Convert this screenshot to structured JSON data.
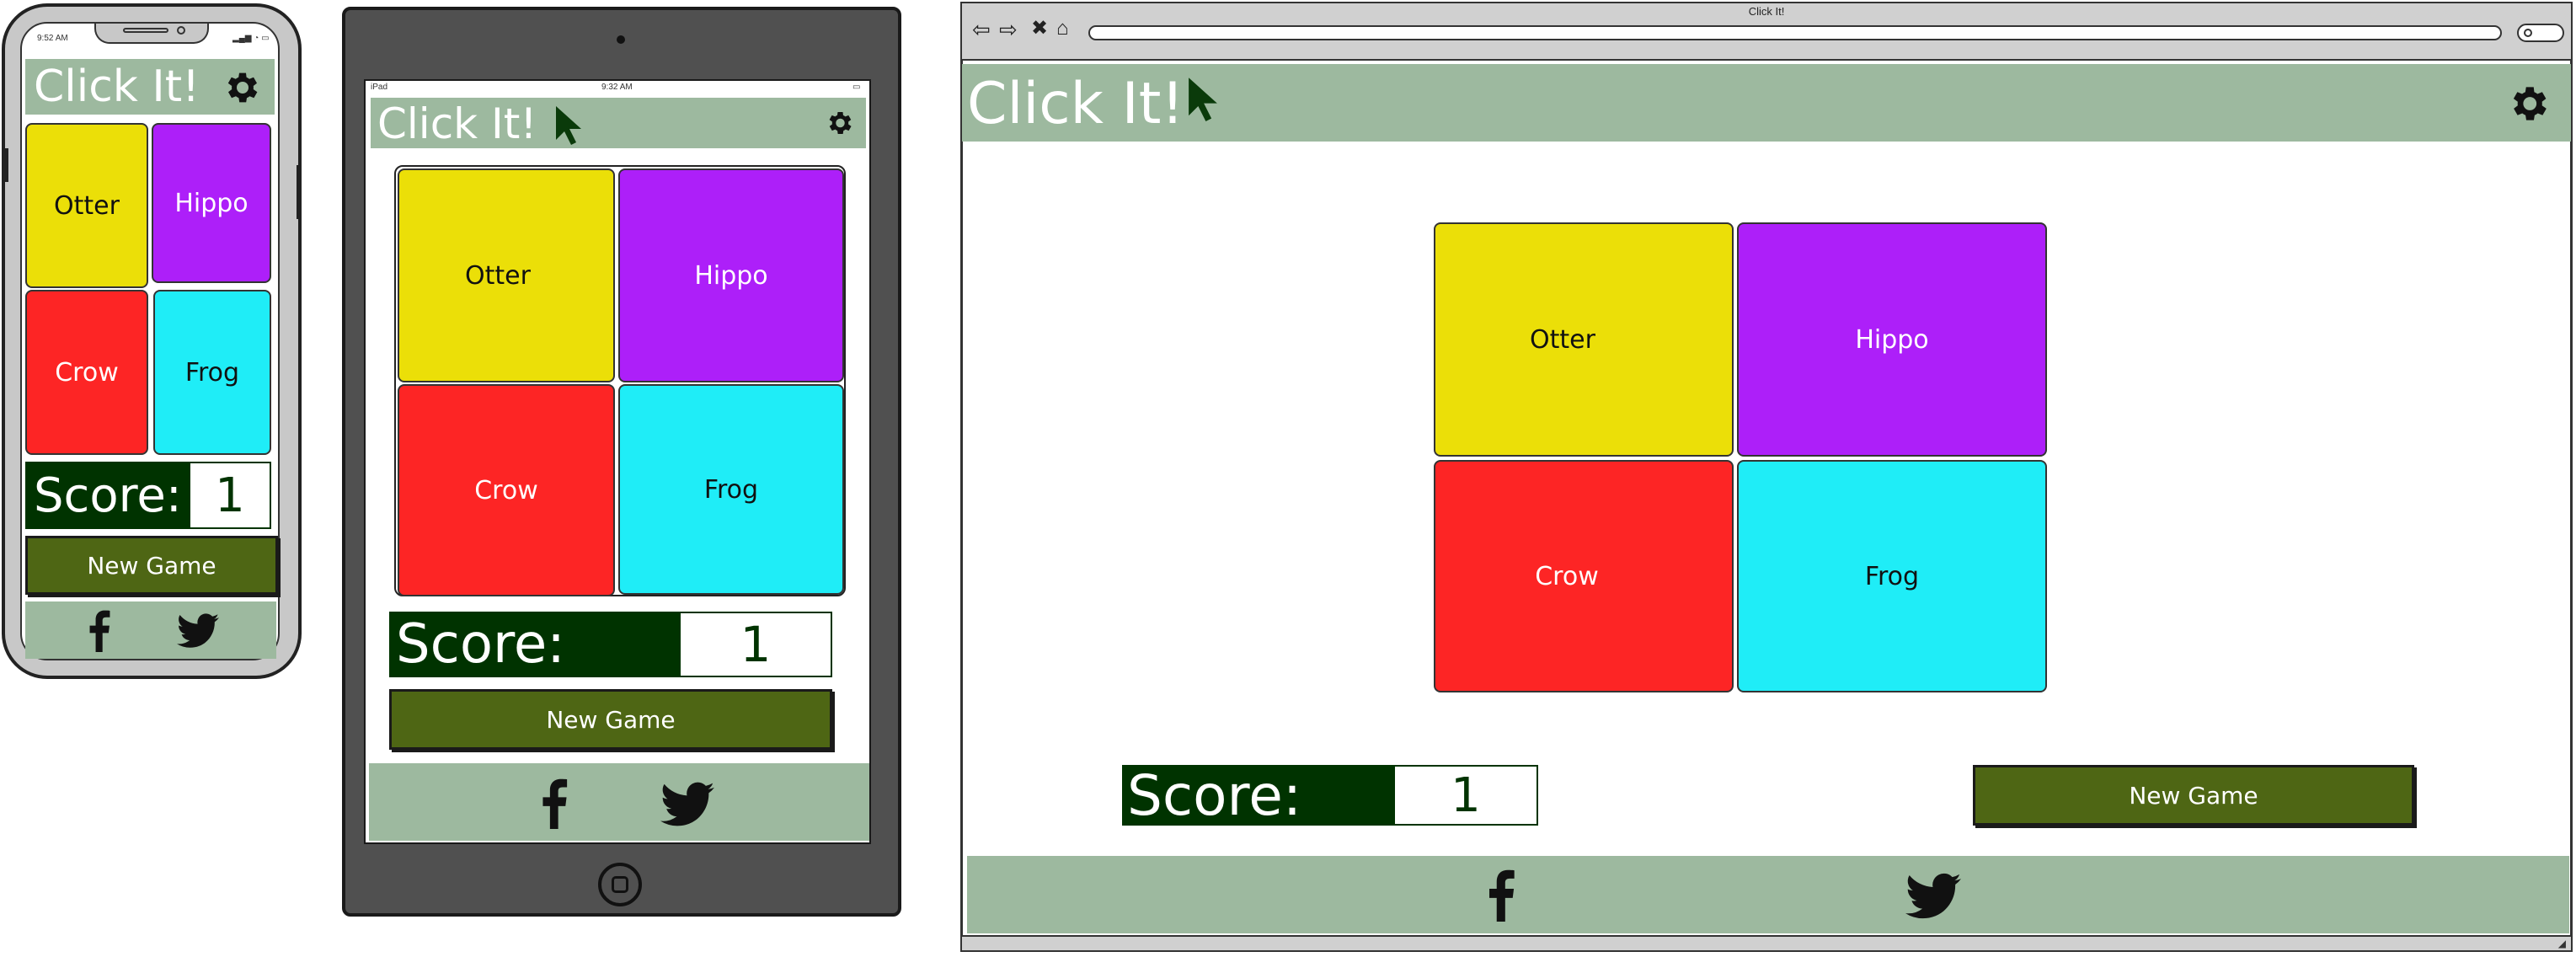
{
  "app": {
    "title": "Click It!"
  },
  "tiles": [
    {
      "label": "Otter",
      "color": "#ebdf08"
    },
    {
      "label": "Hippo",
      "color": "#ad1ff9"
    },
    {
      "label": "Crow",
      "color": "#fd2525"
    },
    {
      "label": "Frog",
      "color": "#1fedf7"
    }
  ],
  "score": {
    "label": "Score:",
    "value": "1"
  },
  "buttons": {
    "new_game": "New Game"
  },
  "phone": {
    "status_time": "9:52 AM"
  },
  "tablet": {
    "status_device": "iPad",
    "status_time": "9:32 AM"
  },
  "browser": {
    "window_title": "Click It!"
  },
  "icons": {
    "settings": "gear-icon",
    "pointer": "cursor-icon",
    "facebook": "facebook-icon",
    "twitter": "twitter-icon"
  },
  "colors": {
    "header": "#9db99f",
    "score_dark": "#003300",
    "button": "#4e6614"
  }
}
